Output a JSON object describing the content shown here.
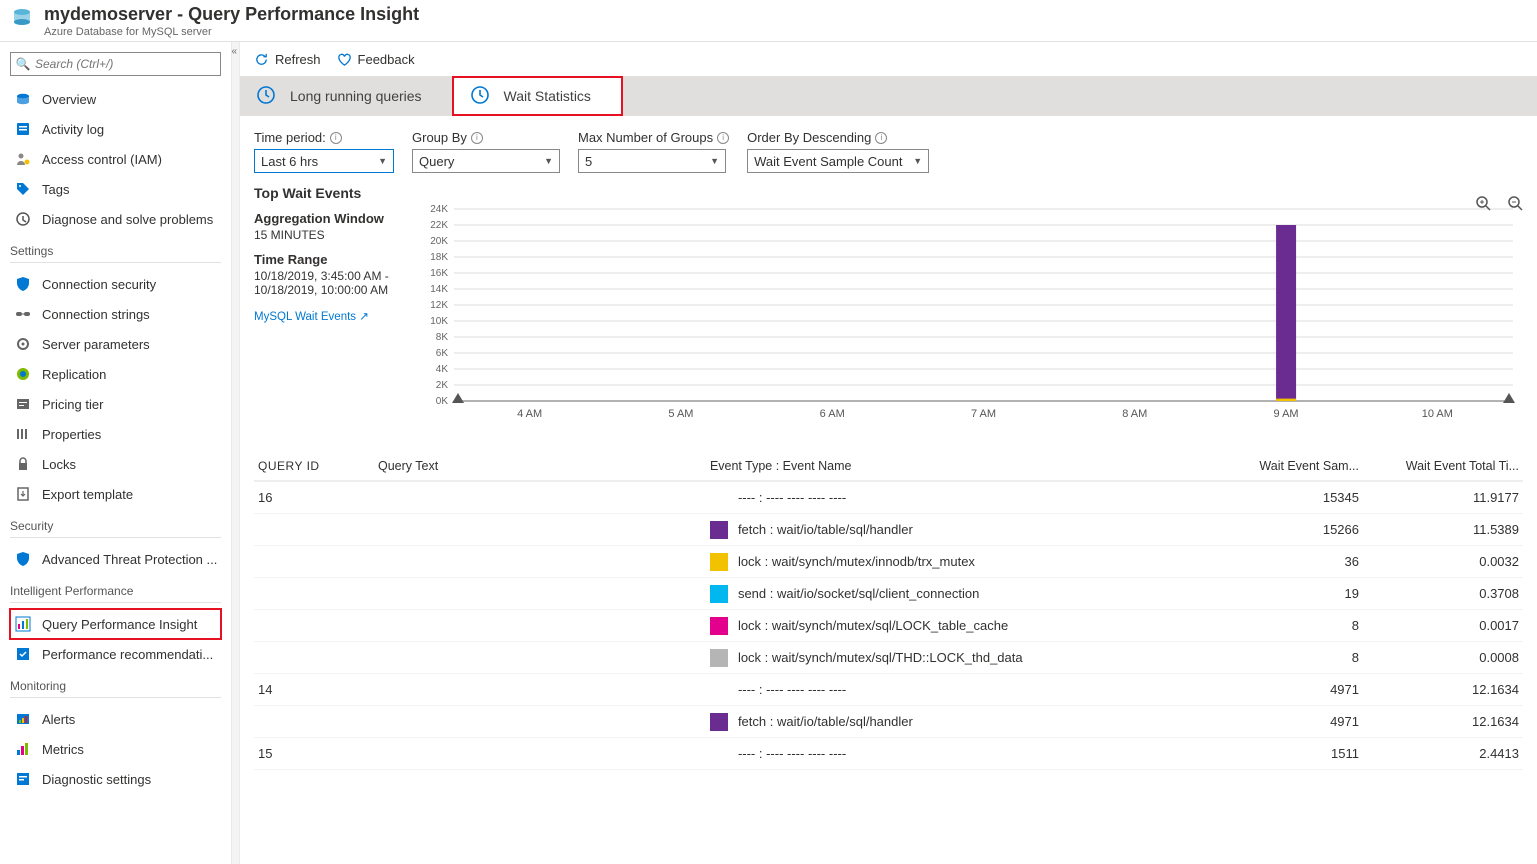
{
  "header": {
    "title": "mydemoserver - Query Performance Insight",
    "subtitle": "Azure Database for MySQL server"
  },
  "sidebar": {
    "search_placeholder": "Search (Ctrl+/)",
    "items": [
      {
        "label": "Overview"
      },
      {
        "label": "Activity log"
      },
      {
        "label": "Access control (IAM)"
      },
      {
        "label": "Tags"
      },
      {
        "label": "Diagnose and solve problems"
      }
    ],
    "settings_header": "Settings",
    "settings": [
      {
        "label": "Connection security"
      },
      {
        "label": "Connection strings"
      },
      {
        "label": "Server parameters"
      },
      {
        "label": "Replication"
      },
      {
        "label": "Pricing tier"
      },
      {
        "label": "Properties"
      },
      {
        "label": "Locks"
      },
      {
        "label": "Export template"
      }
    ],
    "security_header": "Security",
    "security": [
      {
        "label": "Advanced Threat Protection ..."
      }
    ],
    "intelligent_header": "Intelligent Performance",
    "intelligent": [
      {
        "label": "Query Performance Insight"
      },
      {
        "label": "Performance recommendati..."
      }
    ],
    "monitoring_header": "Monitoring",
    "monitoring": [
      {
        "label": "Alerts"
      },
      {
        "label": "Metrics"
      },
      {
        "label": "Diagnostic settings"
      }
    ]
  },
  "commands": {
    "refresh": "Refresh",
    "feedback": "Feedback"
  },
  "tabs": {
    "long_running": "Long running queries",
    "wait_stats": "Wait Statistics"
  },
  "filters": {
    "time_period_label": "Time period:",
    "time_period_value": "Last 6 hrs",
    "group_by_label": "Group By",
    "group_by_value": "Query",
    "max_groups_label": "Max Number of Groups",
    "max_groups_value": "5",
    "order_by_label": "Order By Descending",
    "order_by_value": "Wait Event Sample Count"
  },
  "content": {
    "top_wait_events": "Top Wait Events",
    "agg_window_label": "Aggregation Window",
    "agg_window_value": "15 MINUTES",
    "time_range_label": "Time Range",
    "time_range_value": "10/18/2019, 3:45:00 AM - 10/18/2019, 10:00:00 AM",
    "link_text": "MySQL Wait Events"
  },
  "table": {
    "cols": {
      "qid": "QUERY ID",
      "qt": "Query Text",
      "et": "Event Type : Event Name",
      "wes": "Wait Event Sam...",
      "wet": "Wait Event Total Ti..."
    },
    "rows": [
      {
        "qid": "16",
        "event": "---- : ---- ---- ---- ----",
        "wes": "15345",
        "wet": "11.9177",
        "sub": [
          {
            "color": "#6b2c91",
            "event": "fetch : wait/io/table/sql/handler",
            "wes": "15266",
            "wet": "11.5389"
          },
          {
            "color": "#f2c200",
            "event": "lock : wait/synch/mutex/innodb/trx_mutex",
            "wes": "36",
            "wet": "0.0032"
          },
          {
            "color": "#00b7f0",
            "event": "send : wait/io/socket/sql/client_connection",
            "wes": "19",
            "wet": "0.3708"
          },
          {
            "color": "#e3008c",
            "event": "lock : wait/synch/mutex/sql/LOCK_table_cache",
            "wes": "8",
            "wet": "0.0017"
          },
          {
            "color": "#b5b5b5",
            "event": "lock : wait/synch/mutex/sql/THD::LOCK_thd_data",
            "wes": "8",
            "wet": "0.0008"
          }
        ]
      },
      {
        "qid": "14",
        "event": "---- : ---- ---- ---- ----",
        "wes": "4971",
        "wet": "12.1634",
        "sub": [
          {
            "color": "#6b2c91",
            "event": "fetch : wait/io/table/sql/handler",
            "wes": "4971",
            "wet": "12.1634"
          }
        ]
      },
      {
        "qid": "15",
        "event": "---- : ---- ---- ---- ----",
        "wes": "1511",
        "wet": "2.4413",
        "sub": []
      }
    ]
  },
  "chart_data": {
    "type": "bar",
    "title": "Top Wait Events",
    "xlabel": "",
    "ylabel": "",
    "y_ticks": [
      "0K",
      "2K",
      "4K",
      "6K",
      "8K",
      "10K",
      "12K",
      "14K",
      "16K",
      "18K",
      "20K",
      "22K",
      "24K"
    ],
    "x_ticks": [
      "4 AM",
      "5 AM",
      "6 AM",
      "7 AM",
      "8 AM",
      "9 AM",
      "10 AM"
    ],
    "ylim": [
      0,
      24000
    ],
    "series": [
      {
        "name": "fetch : wait/io/table/sql/handler",
        "color": "#6b2c91",
        "points": [
          {
            "x": "9 AM",
            "y": 22000
          }
        ]
      },
      {
        "name": "lock : wait/synch/mutex/innodb/trx_mutex",
        "color": "#f2c200",
        "points": [
          {
            "x": "9 AM",
            "y": 300
          }
        ]
      }
    ]
  }
}
